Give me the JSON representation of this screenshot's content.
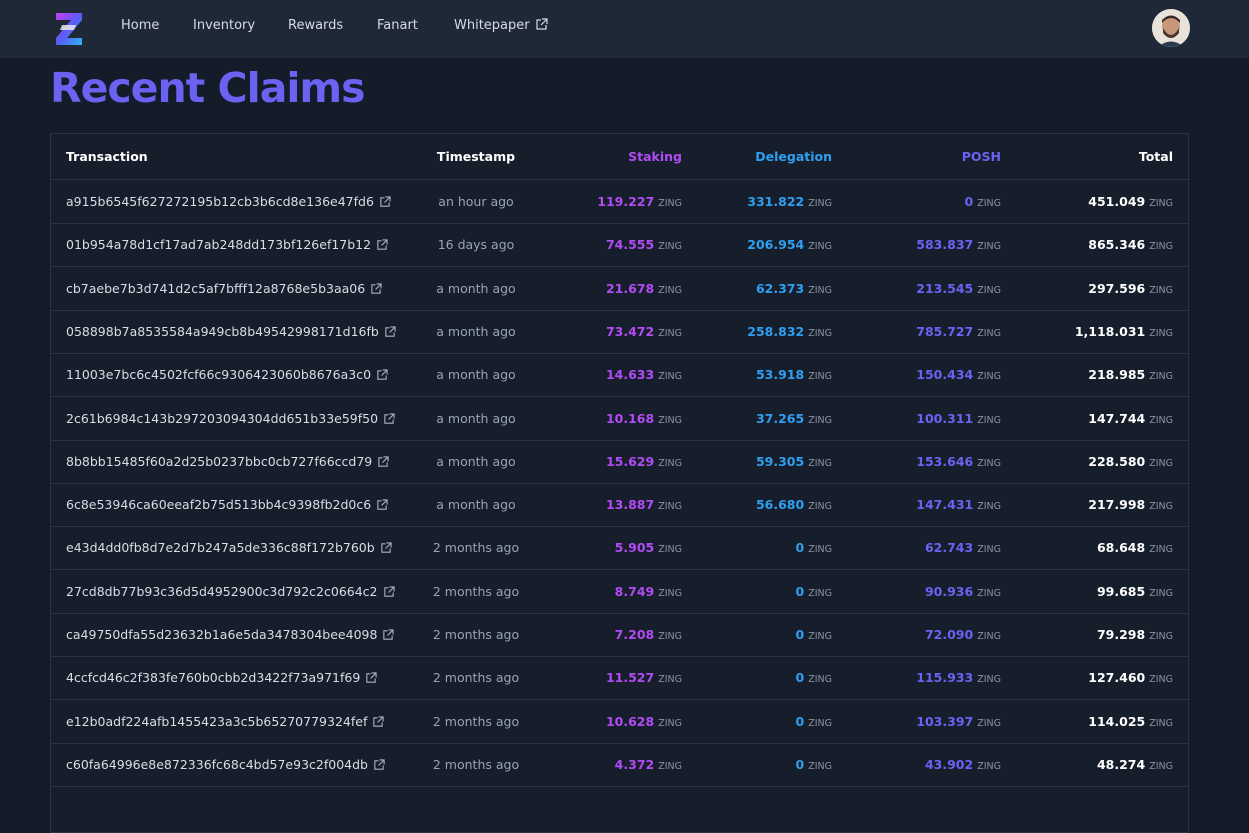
{
  "nav": {
    "links": [
      "Home",
      "Inventory",
      "Rewards",
      "Fanart",
      "Whitepaper"
    ]
  },
  "page_title": "Recent Claims",
  "table": {
    "headers": {
      "transaction": "Transaction",
      "timestamp": "Timestamp",
      "staking": "Staking",
      "delegation": "Delegation",
      "posh": "POSH",
      "total": "Total"
    },
    "unit": "ZING",
    "rows": [
      {
        "tx": "a915b6545f627272195b12cb3b6cd8e136e47fd6",
        "time": "an hour ago",
        "staking": "119.227",
        "delegation": "331.822",
        "posh": "0",
        "total": "451.049"
      },
      {
        "tx": "01b954a78d1cf17ad7ab248dd173bf126ef17b12",
        "time": "16 days ago",
        "staking": "74.555",
        "delegation": "206.954",
        "posh": "583.837",
        "total": "865.346"
      },
      {
        "tx": "cb7aebe7b3d741d2c5af7bfff12a8768e5b3aa06",
        "time": "a month ago",
        "staking": "21.678",
        "delegation": "62.373",
        "posh": "213.545",
        "total": "297.596"
      },
      {
        "tx": "058898b7a8535584a949cb8b49542998171d16fb",
        "time": "a month ago",
        "staking": "73.472",
        "delegation": "258.832",
        "posh": "785.727",
        "total": "1,118.031"
      },
      {
        "tx": "11003e7bc6c4502fcf66c9306423060b8676a3c0",
        "time": "a month ago",
        "staking": "14.633",
        "delegation": "53.918",
        "posh": "150.434",
        "total": "218.985"
      },
      {
        "tx": "2c61b6984c143b297203094304dd651b33e59f50",
        "time": "a month ago",
        "staking": "10.168",
        "delegation": "37.265",
        "posh": "100.311",
        "total": "147.744"
      },
      {
        "tx": "8b8bb15485f60a2d25b0237bbc0cb727f66ccd79",
        "time": "a month ago",
        "staking": "15.629",
        "delegation": "59.305",
        "posh": "153.646",
        "total": "228.580"
      },
      {
        "tx": "6c8e53946ca60eeaf2b75d513bb4c9398fb2d0c6",
        "time": "a month ago",
        "staking": "13.887",
        "delegation": "56.680",
        "posh": "147.431",
        "total": "217.998"
      },
      {
        "tx": "e43d4dd0fb8d7e2d7b247a5de336c88f172b760b",
        "time": "2 months ago",
        "staking": "5.905",
        "delegation": "0",
        "posh": "62.743",
        "total": "68.648"
      },
      {
        "tx": "27cd8db77b93c36d5d4952900c3d792c2c0664c2",
        "time": "2 months ago",
        "staking": "8.749",
        "delegation": "0",
        "posh": "90.936",
        "total": "99.685"
      },
      {
        "tx": "ca49750dfa55d23632b1a6e5da3478304bee4098",
        "time": "2 months ago",
        "staking": "7.208",
        "delegation": "0",
        "posh": "72.090",
        "total": "79.298"
      },
      {
        "tx": "4ccfcd46c2f383fe760b0cbb2d3422f73a971f69",
        "time": "2 months ago",
        "staking": "11.527",
        "delegation": "0",
        "posh": "115.933",
        "total": "127.460"
      },
      {
        "tx": "e12b0adf224afb1455423a3c5b65270779324fef",
        "time": "2 months ago",
        "staking": "10.628",
        "delegation": "0",
        "posh": "103.397",
        "total": "114.025"
      },
      {
        "tx": "c60fa64996e8e872336fc68c4bd57e93c2f004db",
        "time": "2 months ago",
        "staking": "4.372",
        "delegation": "0",
        "posh": "43.902",
        "total": "48.274"
      }
    ]
  },
  "colors": {
    "accent_staking": "#b34bf5",
    "accent_delegation": "#2f9ff0",
    "accent_posh": "#6a63f2",
    "title": "#6a63f2",
    "background": "#141b29"
  },
  "icons": [
    "logo-icon",
    "external-link-icon",
    "avatar"
  ]
}
